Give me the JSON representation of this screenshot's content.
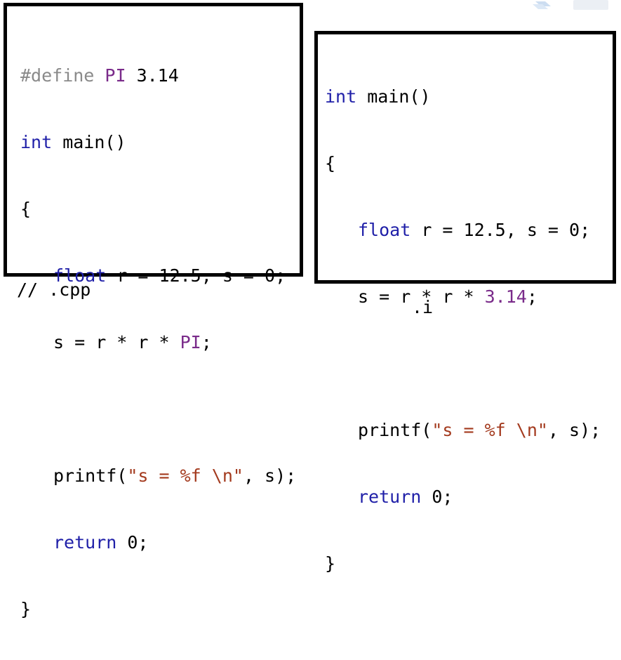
{
  "left_panel": {
    "caption": "// .cpp",
    "lines": {
      "l1_pp": "#define",
      "l1_mac": " PI",
      "l1_rest": " 3.14",
      "l2_kw": "int",
      "l2_rest": " main()",
      "l3": "{",
      "l4_kw": "float",
      "l4_rest": " r = 12.5, s = 0;",
      "l5_pre": "s = r * r * ",
      "l5_mac": "PI",
      "l5_post": ";",
      "l7_pre": "printf(",
      "l7_str": "\"s = %f \\n\"",
      "l7_post": ", s);",
      "l8_kw": "return",
      "l8_rest": " 0;",
      "l9": "}"
    }
  },
  "right_panel": {
    "caption": ".i",
    "lines": {
      "l1_kw": "int",
      "l1_rest": " main()",
      "l2": "{",
      "l3_kw": "float",
      "l3_rest": " r = 12.5, s = 0;",
      "l4_pre": "s = r * r * ",
      "l4_num": "3.14",
      "l4_post": ";",
      "l6_pre": "printf(",
      "l6_str": "\"s = %f \\n\"",
      "l6_post": ", s);",
      "l7_kw": "return",
      "l7_rest": " 0;",
      "l8": "}"
    }
  },
  "colors": {
    "keyword": "#1f1fa8",
    "preprocessor": "#8a8a8a",
    "macro": "#7a2b8a",
    "string": "#a33a1e",
    "border": "#000000"
  }
}
